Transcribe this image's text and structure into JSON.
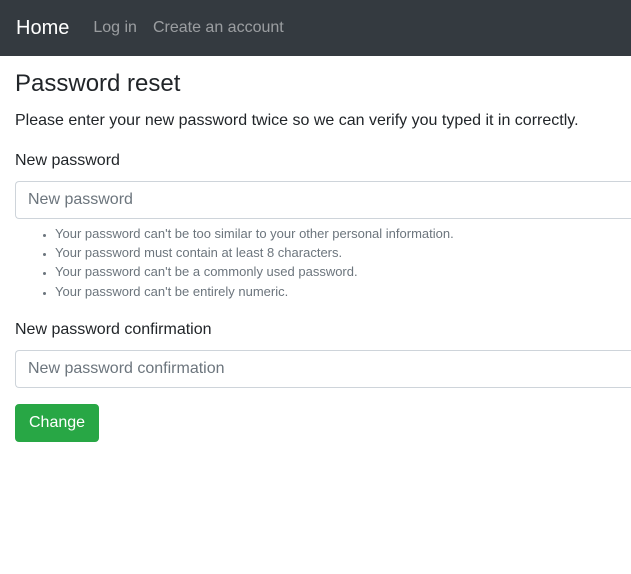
{
  "navbar": {
    "brand": "Home",
    "links": [
      "Log in",
      "Create an account"
    ]
  },
  "page": {
    "title": "Password reset",
    "intro": "Please enter your new password twice so we can verify you typed it in correctly."
  },
  "form": {
    "new_password": {
      "label": "New password",
      "placeholder": "New password",
      "value": ""
    },
    "help_items": [
      "Your password can't be too similar to your other personal information.",
      "Your password must contain at least 8 characters.",
      "Your password can't be a commonly used password.",
      "Your password can't be entirely numeric."
    ],
    "confirm_password": {
      "label": "New password confirmation",
      "placeholder": "New password confirmation",
      "value": ""
    },
    "submit_label": "Change"
  },
  "colors": {
    "navbar_bg": "#343a40",
    "button_bg": "#28a745"
  }
}
